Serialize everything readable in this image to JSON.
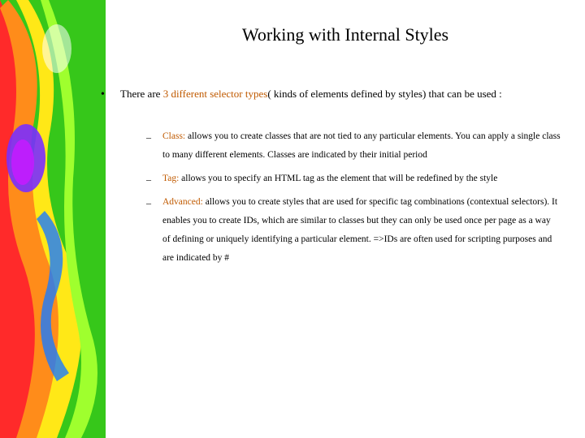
{
  "title": "Working with Internal Styles",
  "intro": {
    "prefix": "There are ",
    "highlight": "3 different selector types",
    "suffix": "( kinds of elements defined by styles) that can be used :"
  },
  "items": [
    {
      "label": "Class:",
      "body": " allows you to create classes that are not tied to any particular elements. You can apply a single class to many different elements. Classes are indicated by their initial period"
    },
    {
      "label": "Tag:",
      "body": " allows you to specify an HTML tag as the element that will be redefined by the style"
    },
    {
      "label": "Advanced:",
      "body": " allows you to create styles that are used for specific tag combinations (contextual selectors). It enables you to create IDs, which are similar to classes but they can only be used once per page as a way of defining or uniquely identifying a particular element. =>IDs are often used for scripting purposes and are indicated by #"
    }
  ]
}
